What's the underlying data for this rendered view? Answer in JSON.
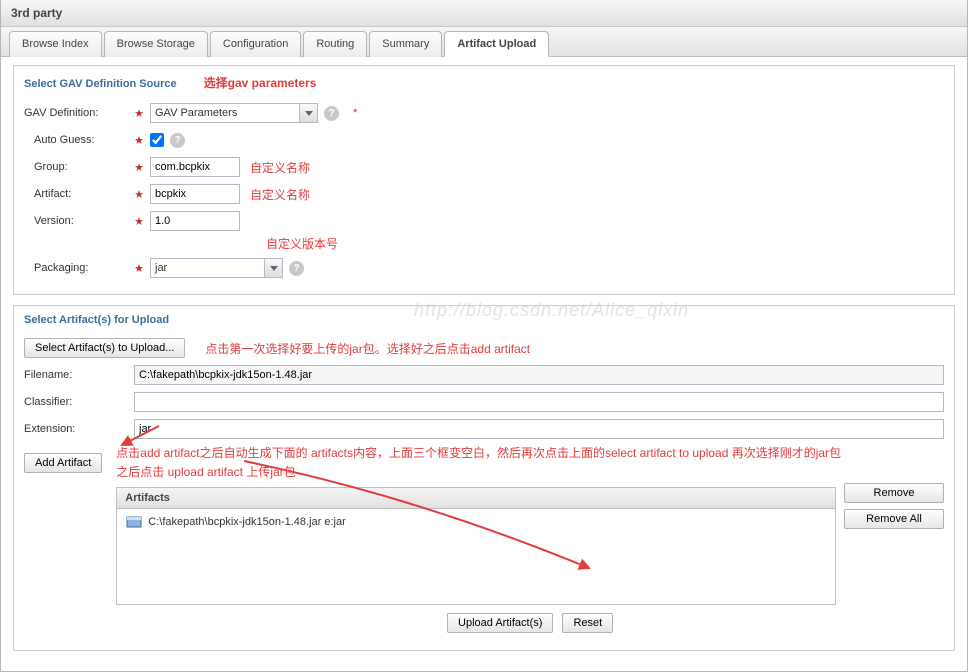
{
  "header": {
    "title": "3rd party"
  },
  "tabs": [
    {
      "label": "Browse Index"
    },
    {
      "label": "Browse Storage"
    },
    {
      "label": "Configuration"
    },
    {
      "label": "Routing"
    },
    {
      "label": "Summary"
    },
    {
      "label": "Artifact Upload"
    }
  ],
  "gav": {
    "legend": "Select GAV Definition Source",
    "definition_label": "GAV Definition:",
    "definition_value": "GAV Parameters",
    "auto_guess_label": "Auto Guess:",
    "auto_guess_checked": true,
    "group_label": "Group:",
    "group_value": "com.bcpkix",
    "artifact_label": "Artifact:",
    "artifact_value": "bcpkix",
    "version_label": "Version:",
    "version_value": "1.0",
    "packaging_label": "Packaging:",
    "packaging_value": "jar"
  },
  "upload": {
    "legend": "Select Artifact(s) for Upload",
    "select_button": "Select Artifact(s) to Upload...",
    "filename_label": "Filename:",
    "filename_value": "C:\\fakepath\\bcpkix-jdk15on-1.48.jar",
    "classifier_label": "Classifier:",
    "classifier_value": "",
    "extension_label": "Extension:",
    "extension_value": "jar",
    "add_artifact_button": "Add Artifact",
    "artifacts_header": "Artifacts",
    "artifact_entry": "C:\\fakepath\\bcpkix-jdk15on-1.48.jar e:jar",
    "remove_button": "Remove",
    "remove_all_button": "Remove All",
    "upload_button": "Upload Artifact(s)",
    "reset_button": "Reset"
  },
  "annotations": {
    "a1": "选择gav parameters",
    "a2": "自定义名称",
    "a3": "自定义名称",
    "a4": "自定义版本号",
    "a5": "点击第一次选择好要上传的jar包。选择好之后点击add artifact",
    "a6_line1": "点击add artifact之后自动生成下面的 artifacts内容，上面三个框变空白，然后再次点击上面的select artifact to upload 再次选择刚才的jar包",
    "a6_line2": "之后点击 upload artifact 上传jar包"
  },
  "watermark": "http://blog.csdn.net/Alice_qixin"
}
